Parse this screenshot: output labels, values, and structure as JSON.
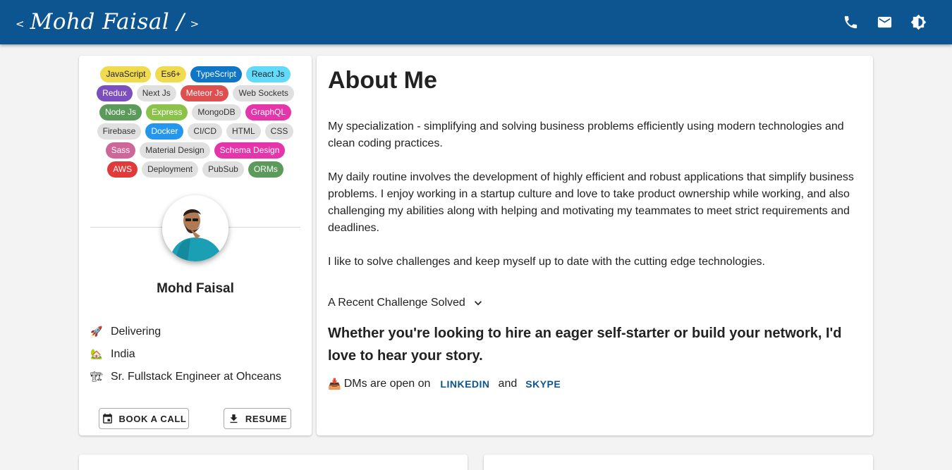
{
  "header": {
    "left_chevron": "<",
    "brand_name": "Mohd Faisal /",
    "right_chevron": ">",
    "icons": [
      "phone-icon",
      "mail-icon",
      "brightness-icon"
    ],
    "bg_color": "#0d5590"
  },
  "skills": [
    {
      "label": "JavaScript",
      "bg": "#f0db4f",
      "fg": "#222"
    },
    {
      "label": "Es6+",
      "bg": "#f0db4f",
      "fg": "#222"
    },
    {
      "label": "TypeScript",
      "bg": "#0f76c6",
      "fg": "#fff"
    },
    {
      "label": "React Js",
      "bg": "#61dafb",
      "fg": "#222"
    },
    {
      "label": "Redux",
      "bg": "#7b4fbd",
      "fg": "#fff"
    },
    {
      "label": "Next Js",
      "bg": "#e0e0e0",
      "fg": "#333"
    },
    {
      "label": "Meteor Js",
      "bg": "#de4f4f",
      "fg": "#fff"
    },
    {
      "label": "Web Sockets",
      "bg": "#e0e0e0",
      "fg": "#333"
    },
    {
      "label": "Node Js",
      "bg": "#5c9a5c",
      "fg": "#fff"
    },
    {
      "label": "Express",
      "bg": "#8bc34a",
      "fg": "#fff"
    },
    {
      "label": "MongoDB",
      "bg": "#e0e0e0",
      "fg": "#333"
    },
    {
      "label": "GraphQL",
      "bg": "#e535ab",
      "fg": "#fff"
    },
    {
      "label": "Firebase",
      "bg": "#e0e0e0",
      "fg": "#333"
    },
    {
      "label": "Docker",
      "bg": "#2496ed",
      "fg": "#fff"
    },
    {
      "label": "CI/CD",
      "bg": "#e0e0e0",
      "fg": "#333"
    },
    {
      "label": "HTML",
      "bg": "#e0e0e0",
      "fg": "#333"
    },
    {
      "label": "CSS",
      "bg": "#e0e0e0",
      "fg": "#333"
    },
    {
      "label": "Sass",
      "bg": "#cd6799",
      "fg": "#fff"
    },
    {
      "label": "Material Design",
      "bg": "#e0e0e0",
      "fg": "#333"
    },
    {
      "label": "Schema Design",
      "bg": "#e535ab",
      "fg": "#fff"
    },
    {
      "label": "AWS",
      "bg": "#e03a3a",
      "fg": "#fff"
    },
    {
      "label": "Deployment",
      "bg": "#e0e0e0",
      "fg": "#333"
    },
    {
      "label": "PubSub",
      "bg": "#e0e0e0",
      "fg": "#333"
    },
    {
      "label": "ORMs",
      "bg": "#5c9a5c",
      "fg": "#fff"
    }
  ],
  "profile": {
    "name": "Mohd Faisal",
    "info": [
      {
        "emoji": "🚀",
        "icon": "rocket-icon",
        "text": "Delivering"
      },
      {
        "emoji": "🏡",
        "icon": "house-icon",
        "text": "India"
      },
      {
        "emoji": "🏗",
        "icon": "construction-icon",
        "text": "Sr. Fullstack Engineer at Ohceans"
      }
    ],
    "book_label": "BOOK A CALL",
    "resume_label": "RESUME"
  },
  "about": {
    "title": "About Me",
    "paragraphs": [
      "My specialization - simplifying and solving business problems efficiently using modern technologies and clean coding practices.",
      "My daily routine involves the development of highly efficient and robust applications that simplify business problems. I enjoy working in a startup culture and love to take product ownership while working, and also challenging my abilities along with helping and motivating my teammates to meet strict requirements and deadlines.",
      "I like to solve challenges and keep myself up to date with the cutting edge technologies."
    ],
    "accordion_label": "A Recent Challenge Solved",
    "cta": "Whether you're looking to hire an eager self-starter or build your network, I'd love to hear your story.",
    "dm_emoji": "📥",
    "dm_text": "DMs are open on",
    "linkedin_label": "LINKEDIN",
    "and_text": "and",
    "skype_label": "SKYPE",
    "link_color": "#0d5590"
  }
}
